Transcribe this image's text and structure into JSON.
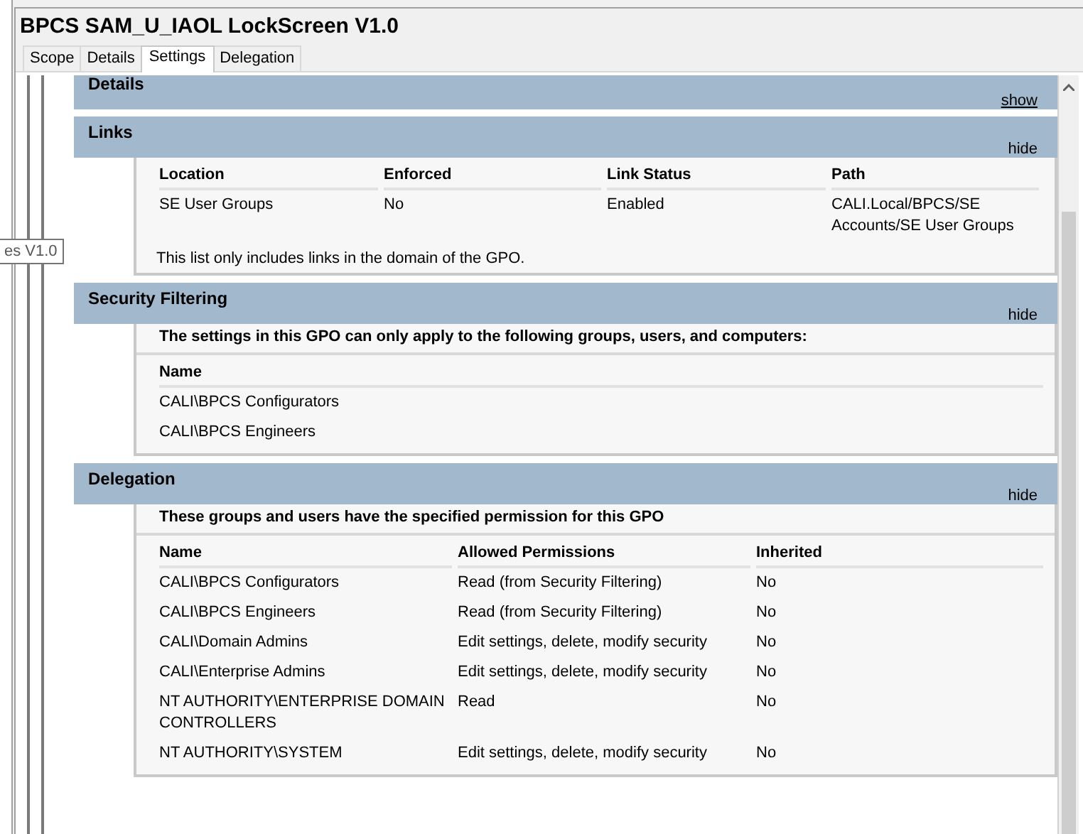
{
  "window": {
    "title": "BPCS SAM_U_IAOL LockScreen V1.0"
  },
  "tabs": [
    {
      "label": "Scope",
      "selected": false
    },
    {
      "label": "Details",
      "selected": false
    },
    {
      "label": "Settings",
      "selected": true
    },
    {
      "label": "Delegation",
      "selected": false
    }
  ],
  "tooltip": {
    "text": "es V1.0"
  },
  "sections": [
    {
      "title": "Details",
      "action": "show",
      "expanded": false
    },
    {
      "title": "Links",
      "action": "hide",
      "expanded": true,
      "table": {
        "columns": [
          "Location",
          "Enforced",
          "Link Status",
          "Path"
        ],
        "rows": [
          [
            "SE User Groups",
            "No",
            "Enabled",
            "CALI.Local/BPCS/SE Accounts/SE User Groups"
          ]
        ]
      },
      "note": "This list only includes links in the domain of the GPO."
    },
    {
      "title": "Security Filtering",
      "action": "hide",
      "expanded": true,
      "intro": "The settings in this GPO can only apply to the following groups, users, and computers:",
      "table": {
        "columns": [
          "Name"
        ],
        "rows": [
          [
            "CALI\\BPCS Configurators"
          ],
          [
            "CALI\\BPCS Engineers"
          ]
        ]
      }
    },
    {
      "title": "Delegation",
      "action": "hide",
      "expanded": true,
      "intro": "These groups and users have the specified permission for this GPO",
      "table": {
        "columns": [
          "Name",
          "Allowed Permissions",
          "Inherited"
        ],
        "rows": [
          [
            "CALI\\BPCS Configurators",
            "Read (from Security Filtering)",
            "No"
          ],
          [
            "CALI\\BPCS Engineers",
            "Read (from Security Filtering)",
            "No"
          ],
          [
            "CALI\\Domain Admins",
            "Edit settings, delete, modify security",
            "No"
          ],
          [
            "CALI\\Enterprise Admins",
            "Edit settings, delete, modify security",
            "No"
          ],
          [
            "NT AUTHORITY\\ENTERPRISE DOMAIN CONTROLLERS",
            "Read",
            "No"
          ],
          [
            "NT AUTHORITY\\SYSTEM",
            "Edit settings, delete, modify security",
            "No"
          ]
        ]
      }
    }
  ]
}
